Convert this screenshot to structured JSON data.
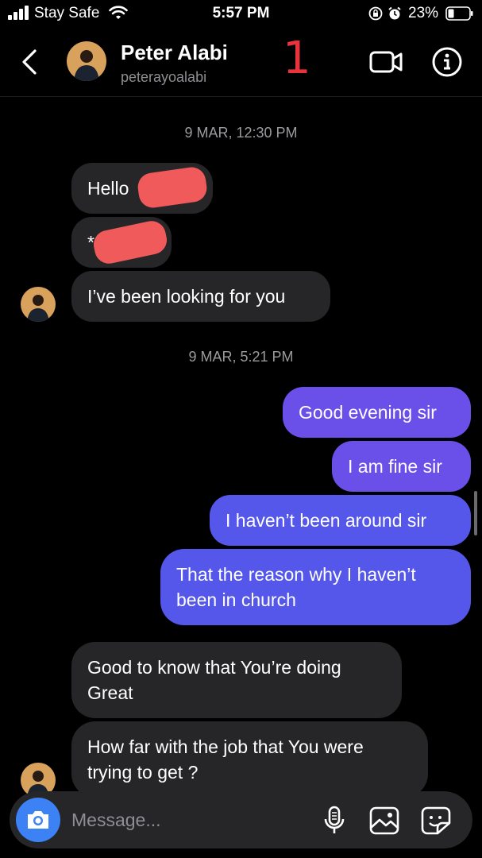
{
  "status_bar": {
    "carrier": "Stay Safe",
    "time": "5:57 PM",
    "battery": "23%"
  },
  "header": {
    "name": "Peter Alabi",
    "username": "peterayoalabi",
    "annotation": "1"
  },
  "messages": {
    "timestamp_1": "9 MAR, 12:30 PM",
    "in_1": "Hello",
    "in_2": "*",
    "in_3": "I’ve been looking for you",
    "timestamp_2": "9 MAR, 5:21 PM",
    "out_1": "Good evening sir",
    "out_2": "I am fine sir",
    "out_3": "I haven’t been around sir",
    "out_4_line1": "That the reason why I haven’t",
    "out_4_line2": "been in church",
    "in_4_line1": "Good to know that You’re doing",
    "in_4_line2": "Great",
    "in_5_line1": "How far with the job that You were",
    "in_5_line2": "trying to get ?"
  },
  "composer": {
    "placeholder": "Message..."
  },
  "colors": {
    "incoming_bubble": "#262628",
    "outgoing_bubble_top": "#6a4fe8",
    "outgoing_bubble_bottom": "#5457ea",
    "camera_button": "#3d82f5",
    "redaction": "#f05a5a",
    "annotation": "#e8323c"
  }
}
